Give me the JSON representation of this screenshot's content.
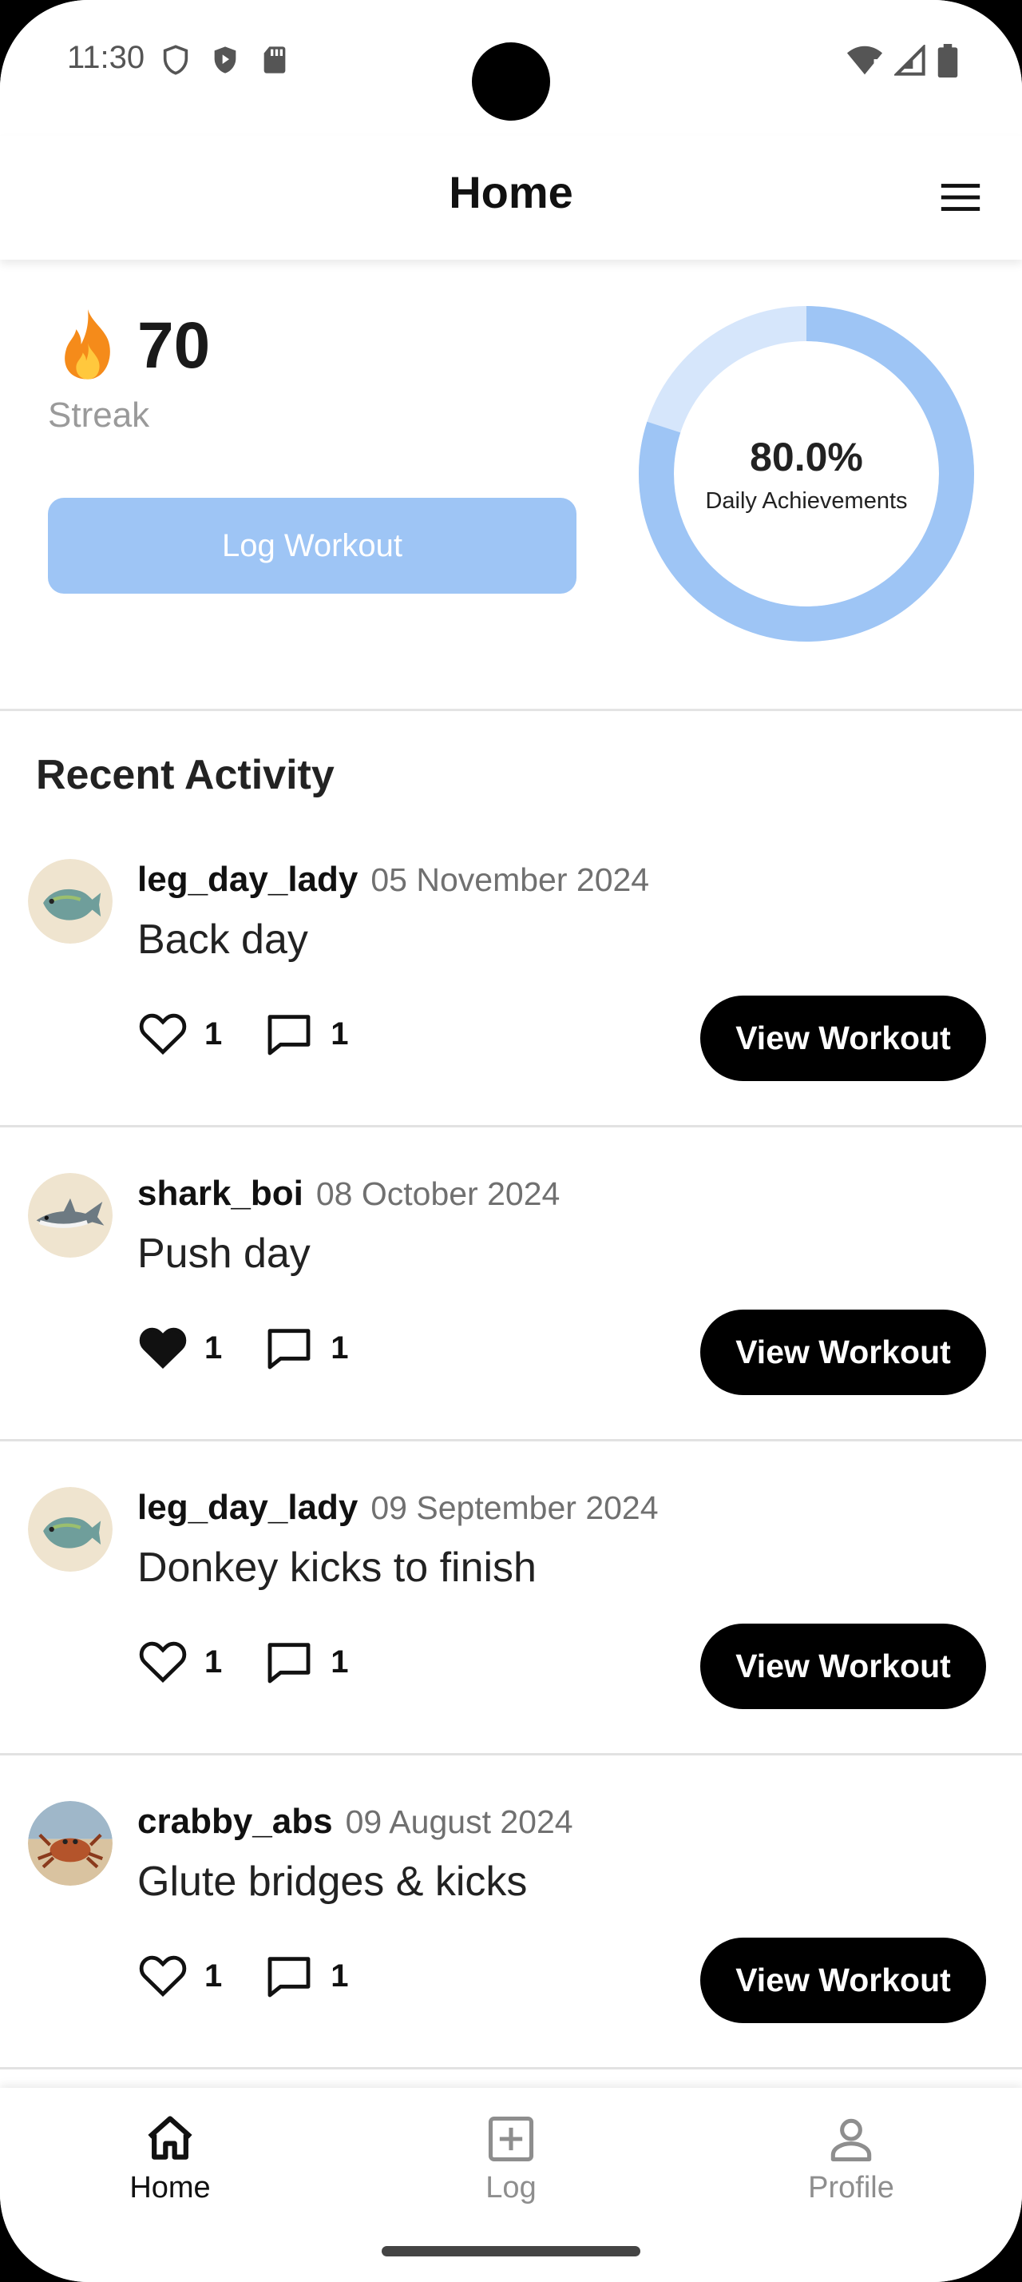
{
  "status_bar": {
    "time": "11:30"
  },
  "header": {
    "title": "Home"
  },
  "summary": {
    "streak_value": "70",
    "streak_label": "Streak",
    "log_button": "Log Workout",
    "achievement_percent_text": "80.0%",
    "achievement_fraction": 0.8,
    "achievement_label": "Daily Achievements",
    "colors": {
      "donut_fill": "#9ec5f5",
      "donut_track": "#d6e6fb",
      "button": "#9ec5f5"
    }
  },
  "activity": {
    "title": "Recent Activity",
    "posts": [
      {
        "user": "leg_day_lady",
        "date": "05 November 2024",
        "title": "Back day",
        "likes": "1",
        "comments": "1",
        "liked": false,
        "avatar": "fish-avatar",
        "button": "View Workout"
      },
      {
        "user": "shark_boi",
        "date": "08 October 2024",
        "title": "Push day",
        "likes": "1",
        "comments": "1",
        "liked": true,
        "avatar": "shark-avatar",
        "button": "View Workout"
      },
      {
        "user": "leg_day_lady",
        "date": "09 September 2024",
        "title": "Donkey kicks to finish",
        "likes": "1",
        "comments": "1",
        "liked": false,
        "avatar": "fish-avatar",
        "button": "View Workout"
      },
      {
        "user": "crabby_abs",
        "date": "09 August 2024",
        "title": "Glute bridges & kicks",
        "likes": "1",
        "comments": "1",
        "liked": false,
        "avatar": "crab-avatar",
        "button": "View Workout"
      }
    ]
  },
  "bottom_nav": {
    "items": [
      {
        "label": "Home",
        "icon": "home-icon",
        "active": true
      },
      {
        "label": "Log",
        "icon": "plus-square-icon",
        "active": false
      },
      {
        "label": "Profile",
        "icon": "person-icon",
        "active": false
      }
    ]
  }
}
